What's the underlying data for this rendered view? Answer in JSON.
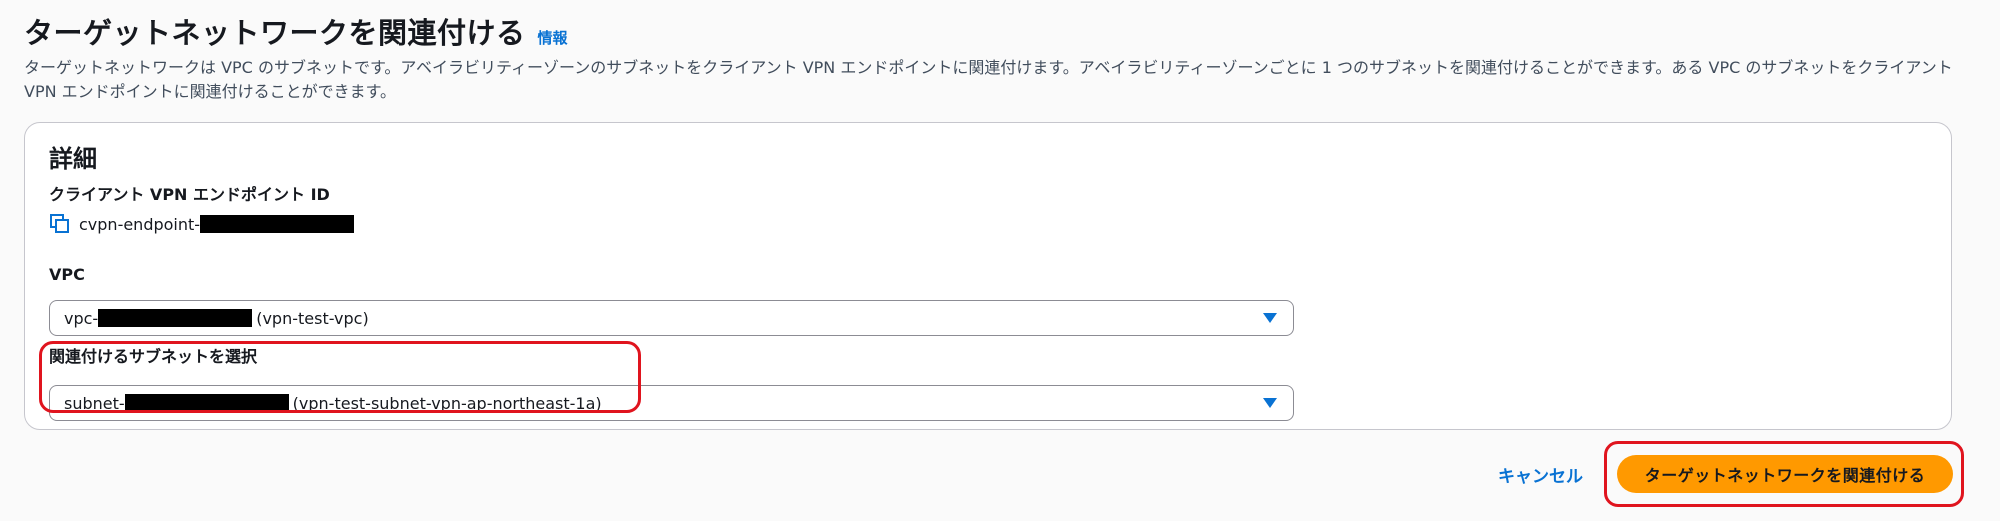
{
  "header": {
    "title": "ターゲットネットワークを関連付ける",
    "info_link": "情報",
    "description": "ターゲットネットワークは VPC のサブネットです。アベイラビリティーゾーンのサブネットをクライアント VPN エンドポイントに関連付けます。アベイラビリティーゾーンごとに 1 つのサブネットを関連付けることができます。ある VPC のサブネットをクライアント VPN エンドポイントに関連付けることができます。"
  },
  "details": {
    "section_title": "詳細",
    "endpoint": {
      "label": "クライアント VPN エンドポイント ID",
      "value_prefix": "cvpn-endpoint-",
      "icon": "copy-icon"
    },
    "vpc": {
      "label": "VPC",
      "value_prefix": "vpc-",
      "value_suffix": "(vpn-test-vpc)"
    },
    "subnet": {
      "label": "関連付けるサブネットを選択",
      "value_prefix": "subnet-",
      "value_suffix": "(vpn-test-subnet-vpn-ap-northeast-1a)"
    }
  },
  "actions": {
    "cancel_label": "キャンセル",
    "submit_label": "ターゲットネットワークを関連付ける"
  },
  "colors": {
    "accent_link": "#0972d3",
    "primary_button": "#ff9900",
    "highlight_box": "#e0141e"
  }
}
